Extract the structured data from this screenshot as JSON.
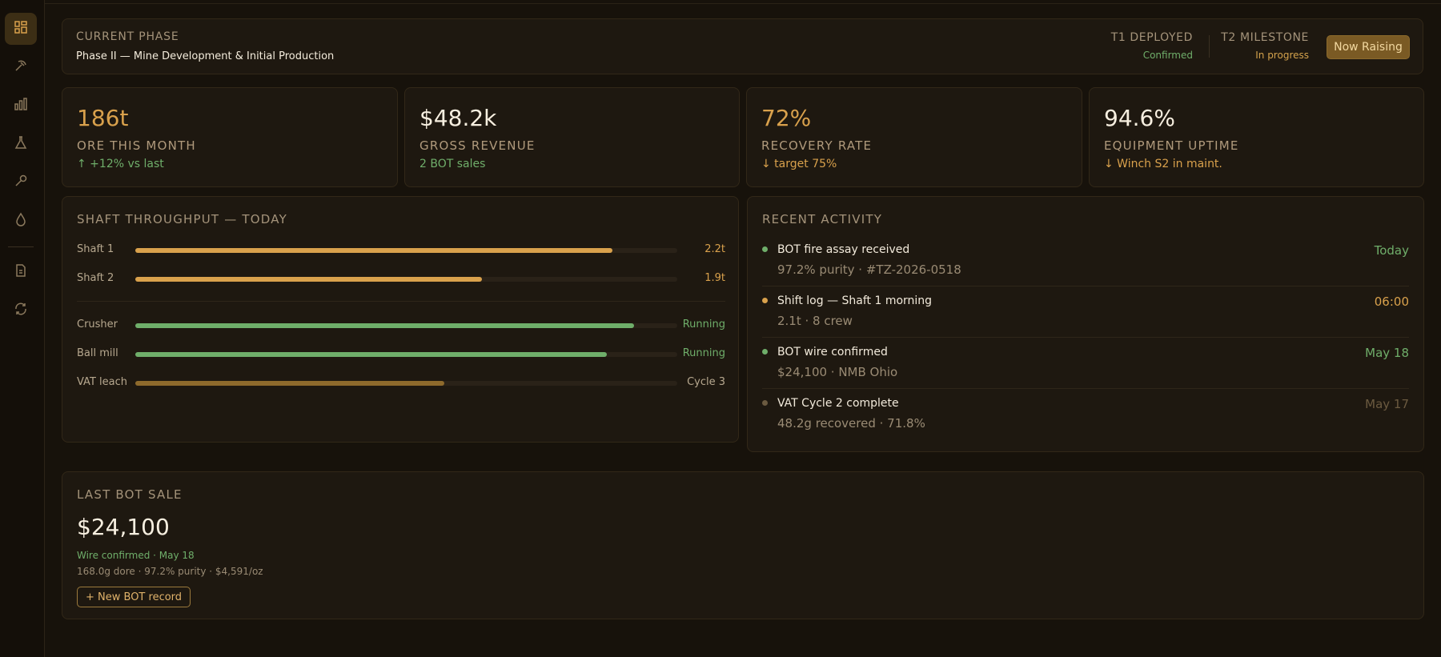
{
  "sidebar": {
    "icons": [
      "dashboard-icon",
      "pickaxe-icon",
      "bar-chart-icon",
      "flask-icon",
      "wrench-icon",
      "droplet-icon",
      "document-icon",
      "refresh-icon"
    ]
  },
  "phase": {
    "title": "CURRENT PHASE",
    "subtitle": "Phase II — Mine Development & Initial Production",
    "milestones": [
      {
        "label": "T1 DEPLOYED",
        "status": "Confirmed",
        "color": "#6fae6a"
      },
      {
        "label": "T2 MILESTONE",
        "status": "In progress",
        "color": "#d4a24c"
      }
    ],
    "button": "Now Raising"
  },
  "stats": [
    {
      "value": "186t",
      "label": "ORE THIS MONTH",
      "sub": "↑ +12% vs last",
      "value_color": "#d9a14c",
      "sub_color": "#6fae6a"
    },
    {
      "value": "$48.2k",
      "label": "GROSS REVENUE",
      "sub": "2 BOT sales",
      "value_color": "#f7efe0",
      "sub_color": "#6fae6a"
    },
    {
      "value": "72%",
      "label": "RECOVERY RATE",
      "sub": "↓ target 75%",
      "value_color": "#d9a14c",
      "sub_color": "#d9a14c"
    },
    {
      "value": "94.6%",
      "label": "EQUIPMENT UPTIME",
      "sub": "↓ Winch S2 in maint.",
      "value_color": "#f7efe0",
      "sub_color": "#d9a14c"
    }
  ],
  "throughput": {
    "title": "SHAFT THROUGHPUT — TODAY",
    "rows": [
      {
        "name": "Shaft 1",
        "value": "2.2t",
        "fill": 0.88,
        "color": "#d9a14c",
        "value_color": "#d9a14c"
      },
      {
        "name": "Shaft 2",
        "value": "1.9t",
        "fill": 0.64,
        "color": "#d9a14c",
        "value_color": "#d9a14c"
      },
      {
        "name": "Crusher",
        "value": "Running",
        "fill": 0.92,
        "color": "#6fae6a",
        "value_color": "#6fae6a"
      },
      {
        "name": "Ball mill",
        "value": "Running",
        "fill": 0.87,
        "color": "#6fae6a",
        "value_color": "#6fae6a"
      },
      {
        "name": "VAT leach",
        "value": "Cycle 3",
        "fill": 0.57,
        "color": "#8e6a2c",
        "value_color": "#b7a88f"
      }
    ]
  },
  "activity": {
    "title": "RECENT ACTIVITY",
    "items": [
      {
        "title": "BOT fire assay received",
        "sub": "97.2% purity · #TZ-2026-0518",
        "time": "Today",
        "dot": "#6fae6a",
        "time_color": "#6fae6a"
      },
      {
        "title": "Shift log — Shaft 1 morning",
        "sub": "2.1t · 8 crew",
        "time": "06:00",
        "dot": "#d9a14c",
        "time_color": "#d9a14c"
      },
      {
        "title": "BOT wire confirmed",
        "sub": "$24,100 · NMB Ohio",
        "time": "May 18",
        "dot": "#6fae6a",
        "time_color": "#6fae6a"
      },
      {
        "title": "VAT Cycle 2 complete",
        "sub": "48.2g recovered · 71.8%",
        "time": "May 17",
        "dot": "#6b5a40",
        "time_color": "#6b5a40"
      }
    ]
  },
  "last_sale": {
    "title": "LAST BOT SALE",
    "amount": "$24,100",
    "confirmed": "Wire confirmed · May 18",
    "detail": "168.0g dore · 97.2% purity · $4,591/oz",
    "button": "+ New BOT record"
  }
}
